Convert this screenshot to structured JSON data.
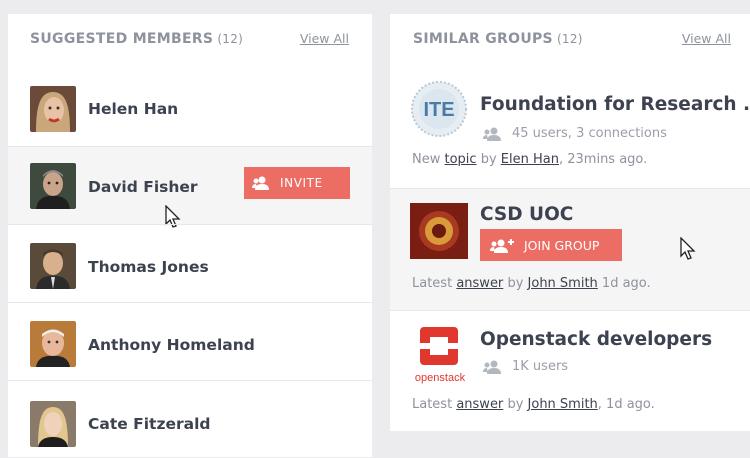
{
  "suggested": {
    "title": "SUGGESTED MEMBERS",
    "count": "(12)",
    "view_all": "View All",
    "members": [
      {
        "name": "Helen Han"
      },
      {
        "name": "David Fisher",
        "action": "INVITE"
      },
      {
        "name": "Thomas Jones"
      },
      {
        "name": "Anthony Homeland"
      },
      {
        "name": "Cate Fitzerald"
      }
    ]
  },
  "similar": {
    "title": "SIMILAR GROUPS",
    "count": "(12)",
    "view_all": "View All",
    "groups": [
      {
        "title": "Foundation for Research ...",
        "logo_text": "ITE",
        "meta": "45 users, 3 connections",
        "activity": {
          "prefix": "New",
          "link": "topic",
          "by": "by",
          "user": "Elen Han",
          "time": ", 23mins ago."
        }
      },
      {
        "title": "CSD UOC",
        "action": "JOIN GROUP",
        "activity": {
          "prefix": "Latest",
          "link": "answer",
          "by": "by",
          "user": "John Smith",
          "time": " 1d ago."
        }
      },
      {
        "title": "Openstack developers",
        "logo_text": "openstack",
        "meta": "1K users",
        "activity": {
          "prefix": "Latest",
          "link": "answer",
          "by": "by",
          "user": "John Smith",
          "time": ",  1d ago."
        }
      }
    ]
  },
  "colors": {
    "accent": "#ec6d64",
    "text": "#3d4250",
    "muted": "#8d929d",
    "background": "#ececee"
  }
}
